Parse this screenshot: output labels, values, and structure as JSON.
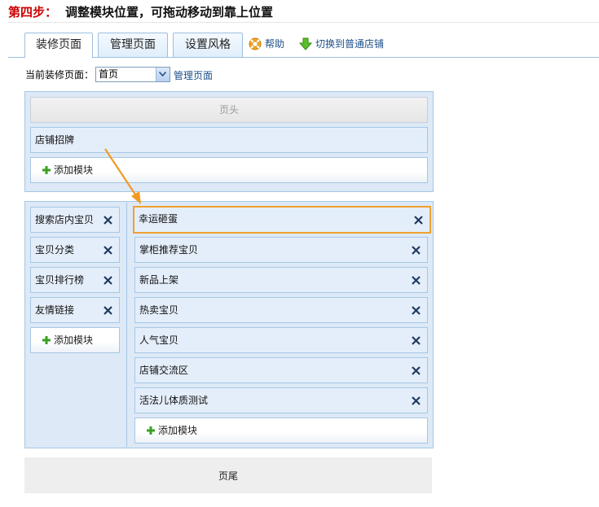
{
  "title": {
    "step_label": "第四步：",
    "text": "调整模块位置，可拖动移动到靠上位置"
  },
  "tabs": [
    {
      "label": "装修页面",
      "active": true
    },
    {
      "label": "管理页面",
      "active": false
    },
    {
      "label": "设置风格",
      "active": false
    }
  ],
  "toolbar": {
    "help": "帮助",
    "switch_shop": "切换到普通店铺"
  },
  "page_selector": {
    "label": "当前装修页面：",
    "value": "首页",
    "manage_link": "管理页面"
  },
  "header_section": {
    "header_label": "页头",
    "modules": [
      {
        "label": "店铺招牌"
      }
    ],
    "add_label": "添加模块"
  },
  "body_section": {
    "left_modules": [
      {
        "label": "搜索店内宝贝"
      },
      {
        "label": "宝贝分类"
      },
      {
        "label": "宝贝排行榜"
      },
      {
        "label": "友情链接"
      }
    ],
    "left_add_label": "添加模块",
    "right_modules": [
      {
        "label": "幸运砸蛋",
        "highlighted": true
      },
      {
        "label": "掌柜推荐宝贝"
      },
      {
        "label": "新品上架"
      },
      {
        "label": "热卖宝贝"
      },
      {
        "label": "人气宝贝"
      },
      {
        "label": "店铺交流区"
      },
      {
        "label": "活法儿体质测试"
      }
    ],
    "right_add_label": "添加模块"
  },
  "footer_label": "页尾",
  "colors": {
    "step_label": "#cc0000",
    "highlight": "#f0a030",
    "link": "#1d4f8a",
    "panel_bg": "#dde9f6",
    "panel_border": "#a6c7e6"
  }
}
